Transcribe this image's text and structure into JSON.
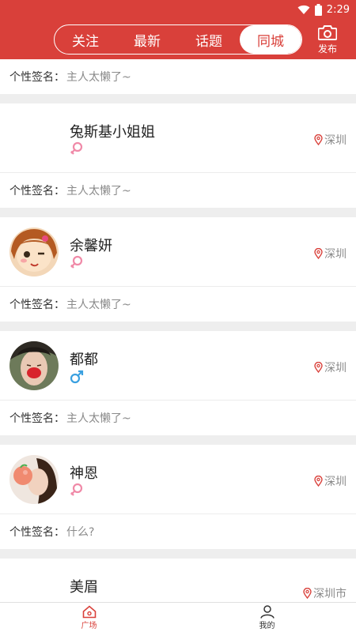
{
  "status": {
    "time": "2:29"
  },
  "header": {
    "tabs": [
      {
        "label": "关注",
        "active": false
      },
      {
        "label": "最新",
        "active": false
      },
      {
        "label": "话题",
        "active": false
      },
      {
        "label": "同城",
        "active": true
      }
    ],
    "publish_label": "发布"
  },
  "signature_label": "个性签名：",
  "first_signature": "主人太懒了~",
  "users": [
    {
      "name": "兔斯基小姐姐",
      "gender": "female",
      "location": "深圳",
      "signature": "主人太懒了~",
      "avatar": "none"
    },
    {
      "name": "余馨妍",
      "gender": "female",
      "location": "深圳",
      "signature": "主人太懒了~",
      "avatar": "cartoon-girl"
    },
    {
      "name": "都都",
      "gender": "male",
      "location": "深圳",
      "signature": "主人太懒了~",
      "avatar": "photo-lips"
    },
    {
      "name": "神恩",
      "gender": "female",
      "location": "深圳",
      "signature": "什么?",
      "avatar": "photo-peach"
    },
    {
      "name": "美眉",
      "gender": "",
      "location": "深圳市",
      "signature": "",
      "avatar": "none"
    }
  ],
  "nav": [
    {
      "label": "广场",
      "active": true
    },
    {
      "label": "我的",
      "active": false
    }
  ],
  "colors": {
    "brand": "#d9403a",
    "female": "#f08aa8",
    "male": "#3aa0e0"
  }
}
